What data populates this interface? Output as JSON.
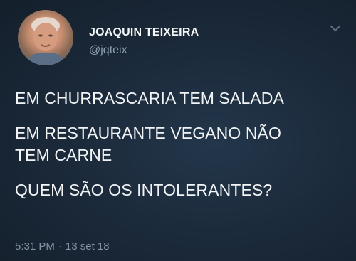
{
  "tweet": {
    "display_name": "JOAQUIN TEIXEIRA",
    "handle": "@jqteix",
    "avatar_icon": "profile-photo",
    "menu_icon": "chevron-down-icon",
    "paragraphs": [
      "EM CHURRASCARIA TEM SALADA",
      "EM RESTAURANTE VEGANO NÃO TEM CARNE",
      "QUEM SÃO OS INTOLERANTES?"
    ],
    "time": "5:31 PM",
    "separator": "·",
    "date": "13 set 18"
  },
  "colors": {
    "background": "#1b2a39",
    "text": "#f2f4f6",
    "secondary_text": "#8ea0b1"
  }
}
